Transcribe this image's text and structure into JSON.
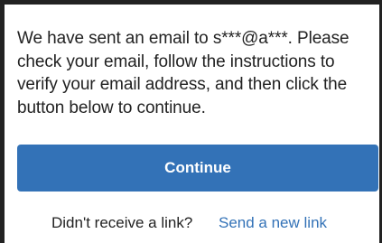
{
  "verification": {
    "message": "We have sent an email to s***@a***. Please check your email, follow the instructions to verify your email address, and then click the button below to continue.",
    "continue_label": "Continue",
    "resend_prompt": "Didn't receive a link?",
    "resend_link_label": "Send a new link"
  },
  "colors": {
    "primary": "#3372b7",
    "text": "#222222",
    "background": "#ffffff"
  }
}
